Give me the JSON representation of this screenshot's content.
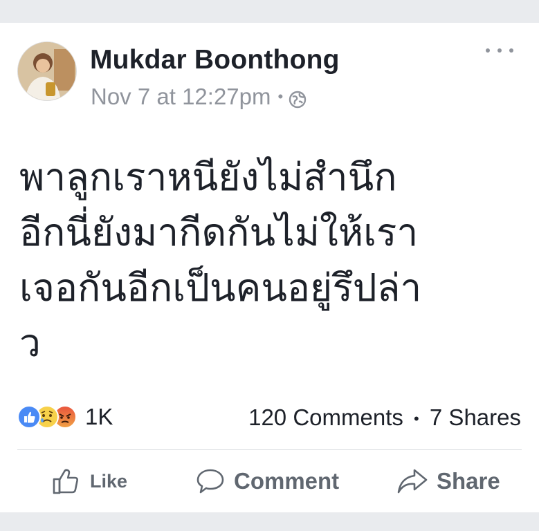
{
  "post": {
    "author": "Mukdar Boonthong",
    "timestamp": "Nov 7 at 12:27pm",
    "separator": "•",
    "privacy_icon": "globe-icon",
    "more_icon": "more-options-icon",
    "text_lines": [
      "พาลูกเราหนียังไม่สำนึก",
      "อีกนี่ยังมากีดกันไม่ให้เรา",
      "เจอกันอีกเป็นคนอยู่รึปล่า",
      "ว"
    ]
  },
  "reactions": {
    "icons": [
      "like-reaction-icon",
      "sad-reaction-icon",
      "angry-reaction-icon"
    ],
    "count": "1K"
  },
  "engagement": {
    "comments": "120 Comments",
    "separator": "•",
    "shares": "7 Shares"
  },
  "actions": {
    "like": "Like",
    "comment": "Comment",
    "share": "Share"
  },
  "colors": {
    "background": "#e9ebee",
    "card": "#ffffff",
    "text_primary": "#1d2129",
    "text_secondary": "#90949c",
    "action_text": "#606770",
    "like_blue": "#4a8af5"
  }
}
